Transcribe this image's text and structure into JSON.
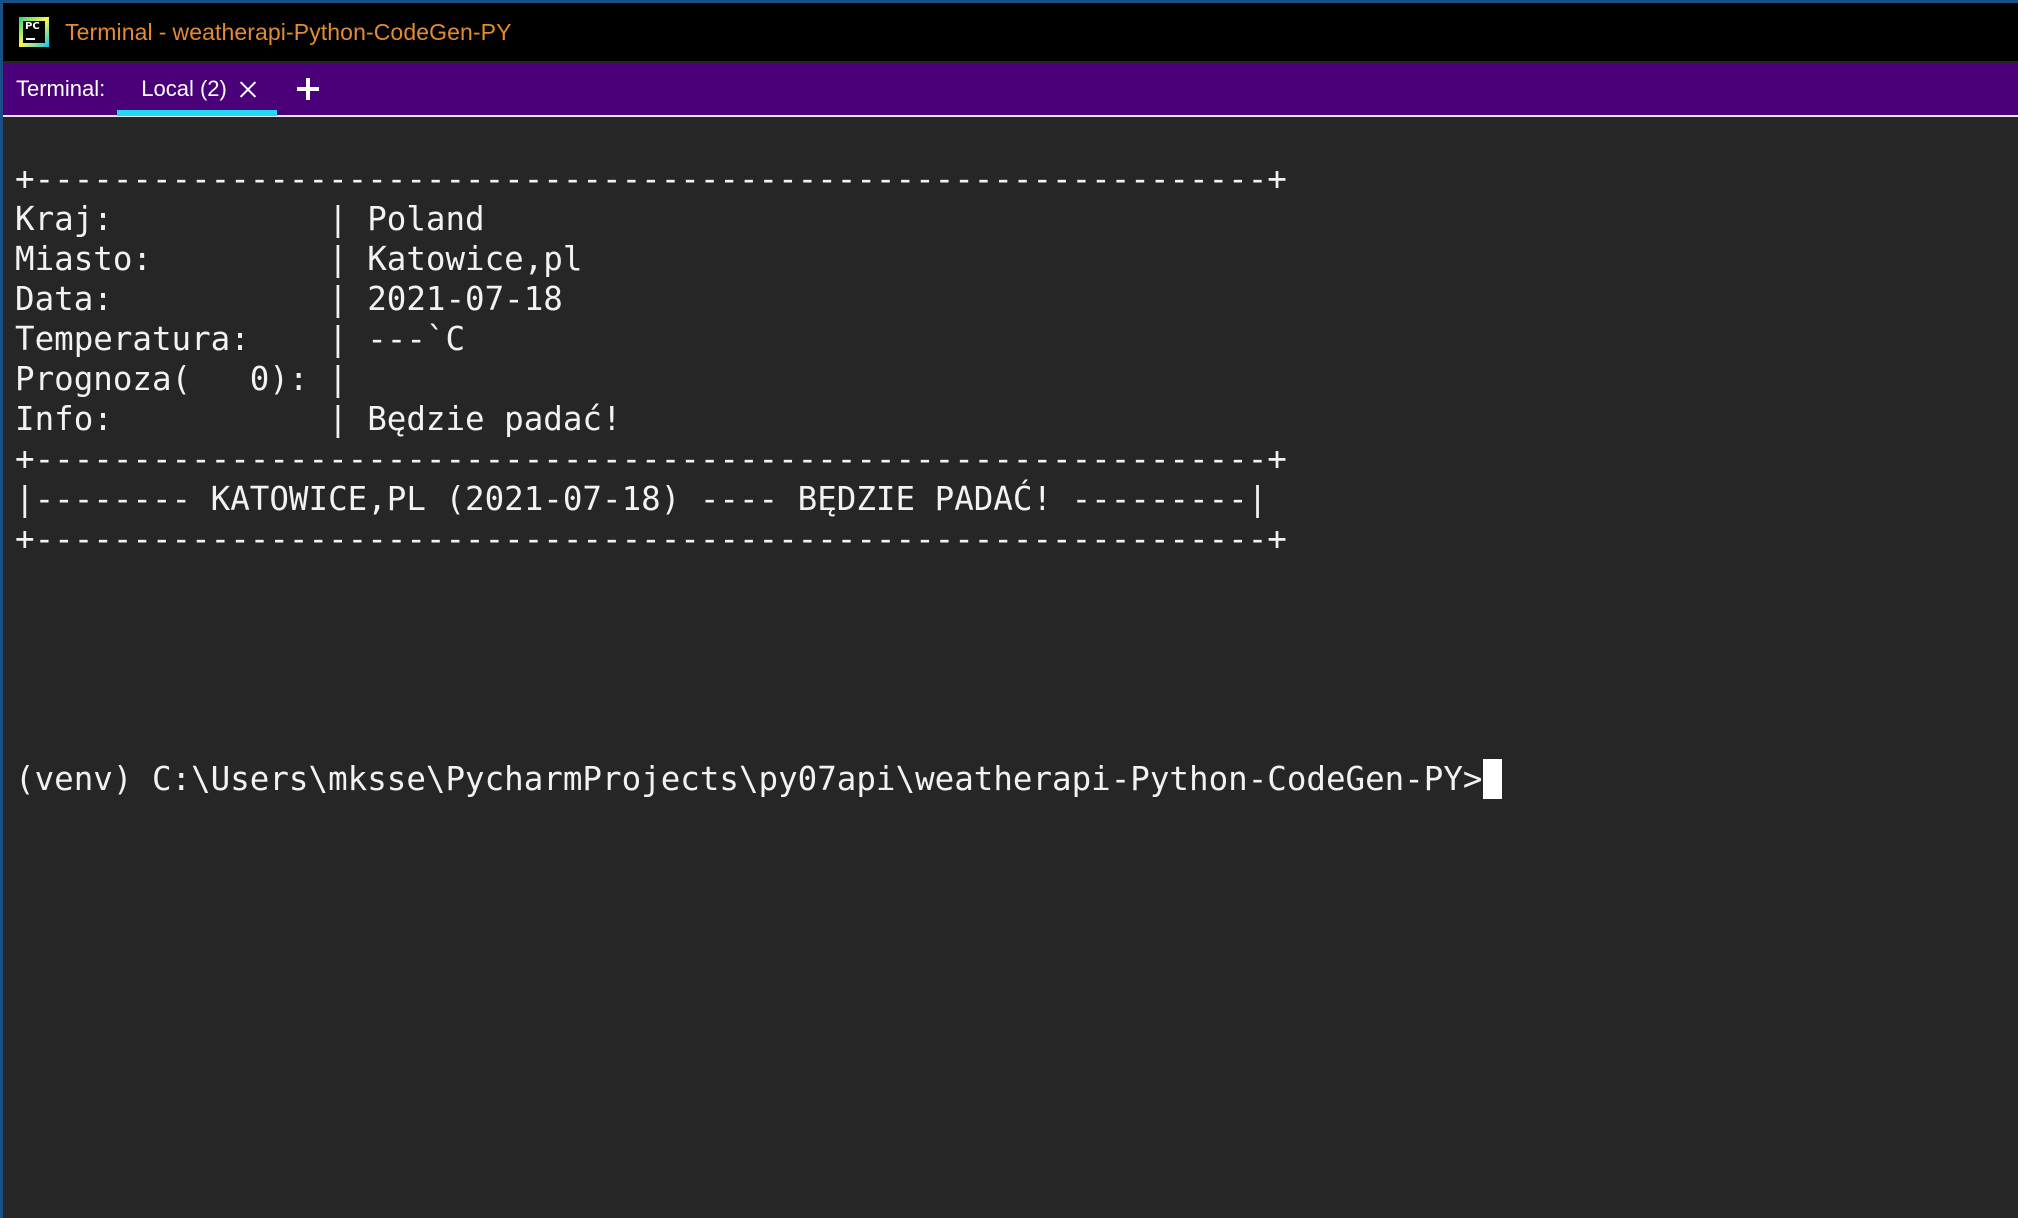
{
  "window": {
    "title_prefix": "Terminal",
    "title_sep": "-",
    "title_project": "weatherapi-Python-CodeGen-PY"
  },
  "tabbar": {
    "prefix": "Terminal:",
    "tabs": [
      {
        "label": "Local (2)",
        "active": true
      }
    ]
  },
  "terminal": {
    "lines": [
      "+---------------------------------------------------------------+",
      "Kraj:           | Poland",
      "Miasto:         | Katowice,pl",
      "Data:           | 2021-07-18",
      "Temperatura:    | ---`C",
      "Prognoza(   0): |",
      "Info:           | Będzie padać!",
      "+---------------------------------------------------------------+",
      "|-------- KATOWICE,PL (2021-07-18) ---- BĘDZIE PADAĆ! ---------|",
      "+---------------------------------------------------------------+"
    ],
    "prompt": "(venv) C:\\Users\\mksse\\PycharmProjects\\py07api\\weatherapi-Python-CodeGen-PY>"
  },
  "colors": {
    "title_text": "#e28b32",
    "tabbar_bg": "#4a0078",
    "tab_underline": "#23d7f5",
    "terminal_bg": "#262626",
    "terminal_text": "#f2f2f2"
  }
}
